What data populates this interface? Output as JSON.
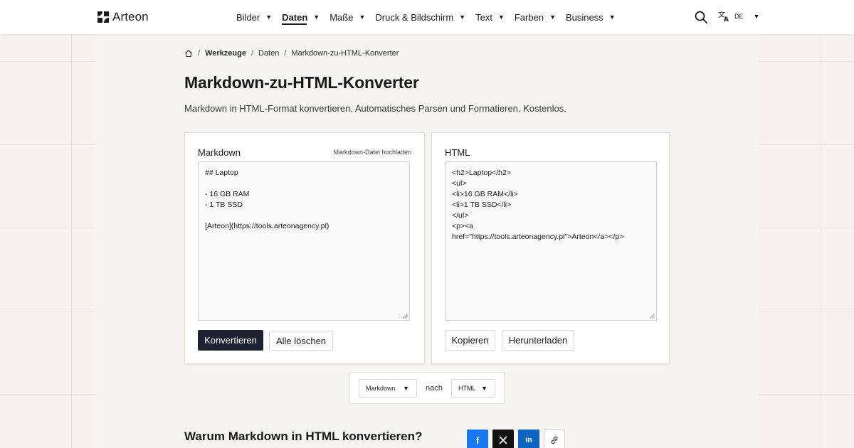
{
  "header": {
    "brand": "Arteon",
    "nav": [
      {
        "label": "Bilder",
        "active": false
      },
      {
        "label": "Daten",
        "active": true
      },
      {
        "label": "Maße",
        "active": false
      },
      {
        "label": "Druck & Bildschirm",
        "active": false
      },
      {
        "label": "Text",
        "active": false
      },
      {
        "label": "Farben",
        "active": false
      },
      {
        "label": "Business",
        "active": false
      }
    ],
    "language": "DE"
  },
  "breadcrumb": {
    "items": [
      "Werkzeuge",
      "Daten"
    ],
    "current": "Markdown-zu-HTML-Konverter"
  },
  "page": {
    "title": "Markdown-zu-HTML-Konverter",
    "subtitle": "Markdown in HTML-Format konvertieren. Automatisches Parsen und Formatieren. Kostenlos."
  },
  "input_panel": {
    "label": "Markdown",
    "upload_link": "Markdown-Datei hochladen",
    "value": "## Laptop\n\n- 16 GB RAM\n- 1 TB SSD\n\n[Arteon](https://tools.arteonagency.pl)",
    "convert_button": "Konvertieren",
    "clear_button": "Alle löschen"
  },
  "output_panel": {
    "label": "HTML",
    "value": "<h2>Laptop</h2>\n<ul>\n<li>16 GB RAM</li>\n<li>1 TB SSD</li>\n</ul>\n<p><a\nhref=\"https://tools.arteonagency.pl\">Arteon</a></p>",
    "copy_button": "Kopieren",
    "download_button": "Herunterladen"
  },
  "format_selector": {
    "from": "Markdown",
    "connector": "nach",
    "to": "HTML"
  },
  "section": {
    "title": "Warum Markdown in HTML konvertieren?"
  },
  "share": [
    {
      "icon": "facebook-icon",
      "glyph": "f",
      "color": "#1877f2"
    },
    {
      "icon": "x-icon",
      "glyph": "𝕏",
      "color": "#111111"
    },
    {
      "icon": "linkedin-icon",
      "glyph": "in",
      "color": "#0a66c2"
    },
    {
      "icon": "link-icon",
      "glyph": "",
      "color": "#ffffff"
    }
  ],
  "colors": {
    "primary_button": "#1e2233",
    "page_background": "#f6f3ef"
  }
}
